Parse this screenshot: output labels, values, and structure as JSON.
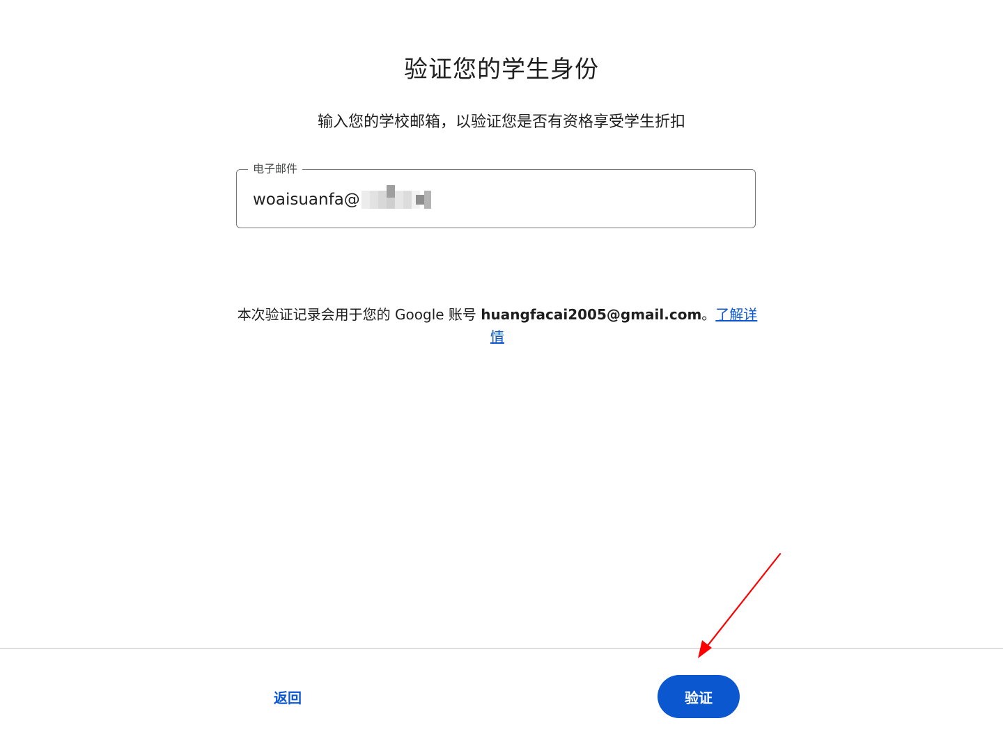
{
  "page": {
    "title": "验证您的学生身份",
    "subtitle": "输入您的学校邮箱，以验证您是否有资格享受学生折扣"
  },
  "email_field": {
    "label": "电子邮件",
    "value_visible": "woaisuanfa@"
  },
  "info": {
    "text_prefix": "本次验证记录会用于您的 Google 账号 ",
    "account": "huangfacai2005@gmail.com",
    "text_suffix": "。",
    "learn_more": "了解详情"
  },
  "footer": {
    "back_label": "返回",
    "verify_label": "验证"
  },
  "colors": {
    "accent": "#0b57d0",
    "annotation_arrow": "#ff0000"
  }
}
